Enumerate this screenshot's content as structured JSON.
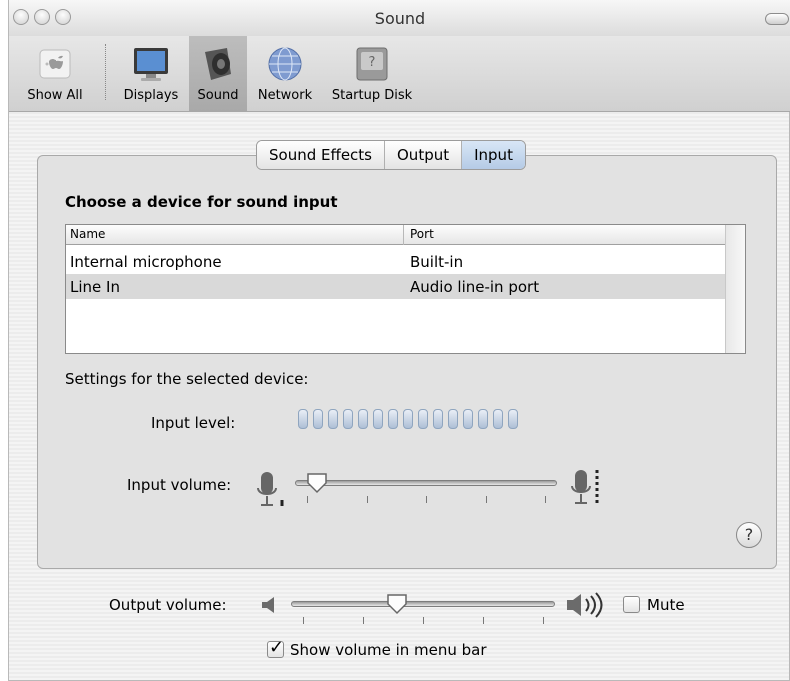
{
  "window": {
    "title": "Sound"
  },
  "toolbar": {
    "items": [
      {
        "label": "Show All",
        "icon": "apple-grid-icon"
      },
      {
        "label": "Displays",
        "icon": "display-icon"
      },
      {
        "label": "Sound",
        "icon": "speaker-icon",
        "selected": true
      },
      {
        "label": "Network",
        "icon": "globe-icon"
      },
      {
        "label": "Startup Disk",
        "icon": "disk-icon"
      }
    ]
  },
  "tabs": [
    {
      "label": "Sound Effects",
      "active": false
    },
    {
      "label": "Output",
      "active": false
    },
    {
      "label": "Input",
      "active": true
    }
  ],
  "input": {
    "heading": "Choose a device for sound input",
    "columns": {
      "name": "Name",
      "port": "Port"
    },
    "devices": [
      {
        "name": "Internal microphone",
        "port": "Built-in",
        "selected": false
      },
      {
        "name": "Line In",
        "port": "Audio line-in port",
        "selected": true
      }
    ],
    "settings_label": "Settings for the selected device:",
    "level_label": "Input level:",
    "level_segments": 15,
    "level_lit": 0,
    "volume_label": "Input volume:",
    "volume_fraction": 0.04
  },
  "output": {
    "volume_label": "Output volume:",
    "volume_fraction": 0.39,
    "mute_label": "Mute",
    "mute_checked": false,
    "show_in_menu_label": "Show volume in menu bar",
    "show_in_menu_checked": true
  },
  "help": {
    "glyph": "?"
  },
  "colors": {
    "selection": "#d9d9d9",
    "active_tab": "#b5cbe6",
    "meter": "#aebfd6"
  }
}
